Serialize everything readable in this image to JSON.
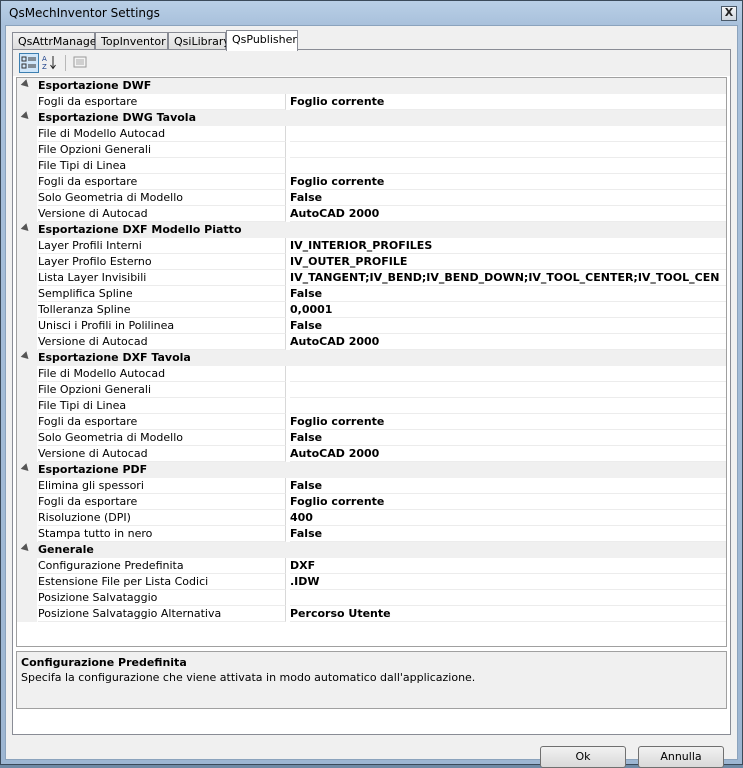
{
  "window": {
    "title": "QsMechInventor Settings",
    "close_glyph": "X"
  },
  "tabs": [
    {
      "label": "QsAttrManager"
    },
    {
      "label": "TopInventor"
    },
    {
      "label": "QsiLibrary"
    },
    {
      "label": "QsPublisher"
    }
  ],
  "toolbar": {
    "sort_az_label": "A Z",
    "buttons": [
      "categorized-view-icon",
      "alphabetical-sort-icon",
      "property-pages-icon"
    ]
  },
  "grid": {
    "categories": [
      {
        "name": "Esportazione DWF",
        "rows": [
          {
            "name": "Fogli da esportare",
            "value": "Foglio corrente"
          }
        ]
      },
      {
        "name": "Esportazione DWG Tavola",
        "rows": [
          {
            "name": "File di Modello Autocad",
            "value": ""
          },
          {
            "name": "File Opzioni Generali",
            "value": ""
          },
          {
            "name": "File Tipi di Linea",
            "value": ""
          },
          {
            "name": "Fogli da esportare",
            "value": "Foglio corrente"
          },
          {
            "name": "Solo Geometria di Modello",
            "value": "False"
          },
          {
            "name": "Versione di Autocad",
            "value": "AutoCAD 2000"
          }
        ]
      },
      {
        "name": "Esportazione DXF Modello Piatto",
        "rows": [
          {
            "name": "Layer Profili Interni",
            "value": "IV_INTERIOR_PROFILES"
          },
          {
            "name": "Layer Profilo Esterno",
            "value": "IV_OUTER_PROFILE"
          },
          {
            "name": "Lista Layer Invisibili",
            "value": "IV_TANGENT;IV_BEND;IV_BEND_DOWN;IV_TOOL_CENTER;IV_TOOL_CEN"
          },
          {
            "name": "Semplifica Spline",
            "value": "False"
          },
          {
            "name": "Tolleranza Spline",
            "value": "0,0001"
          },
          {
            "name": "Unisci i Profili in Polilinea",
            "value": "False"
          },
          {
            "name": "Versione di Autocad",
            "value": "AutoCAD 2000"
          }
        ]
      },
      {
        "name": "Esportazione DXF Tavola",
        "rows": [
          {
            "name": "File di Modello Autocad",
            "value": ""
          },
          {
            "name": "File Opzioni Generali",
            "value": ""
          },
          {
            "name": "File Tipi di Linea",
            "value": ""
          },
          {
            "name": "Fogli da esportare",
            "value": "Foglio corrente"
          },
          {
            "name": "Solo Geometria di Modello",
            "value": "False"
          },
          {
            "name": "Versione di Autocad",
            "value": "AutoCAD 2000"
          }
        ]
      },
      {
        "name": "Esportazione PDF",
        "rows": [
          {
            "name": "Elimina gli spessori",
            "value": "False"
          },
          {
            "name": "Fogli da esportare",
            "value": "Foglio corrente"
          },
          {
            "name": "Risoluzione (DPI)",
            "value": "400"
          },
          {
            "name": "Stampa tutto in nero",
            "value": "False"
          }
        ]
      },
      {
        "name": "Generale",
        "rows": [
          {
            "name": "Configurazione Predefinita",
            "value": "DXF"
          },
          {
            "name": "Estensione File per Lista Codici",
            "value": ".IDW"
          },
          {
            "name": "Posizione Salvataggio",
            "value": ""
          },
          {
            "name": "Posizione Salvataggio Alternativa",
            "value": "Percorso Utente"
          }
        ]
      }
    ]
  },
  "help": {
    "title": "Configurazione Predefinita",
    "description": "Specifa la configurazione che viene attivata in modo automatico dall'applicazione."
  },
  "buttons": {
    "ok": "Ok",
    "cancel": "Annulla"
  }
}
